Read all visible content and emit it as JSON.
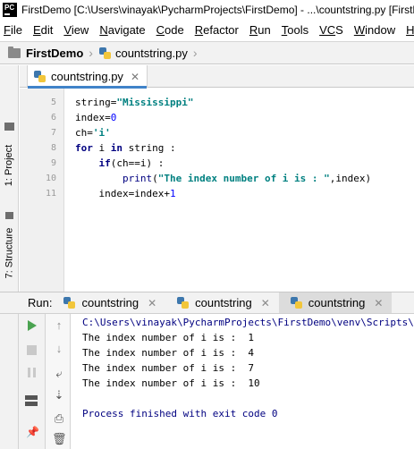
{
  "window": {
    "title": "FirstDemo [C:\\Users\\vinayak\\PycharmProjects\\FirstDemo] - ...\\countstring.py [FirstDemo] - PyCharm",
    "logo_text": "PC"
  },
  "menu": [
    {
      "mnemonic": "F",
      "rest": "ile"
    },
    {
      "mnemonic": "E",
      "rest": "dit"
    },
    {
      "mnemonic": "V",
      "rest": "iew"
    },
    {
      "mnemonic": "N",
      "rest": "avigate"
    },
    {
      "mnemonic": "C",
      "rest": "ode"
    },
    {
      "mnemonic": "R",
      "rest": "efactor"
    },
    {
      "mnemonic": "R",
      "rest": "un"
    },
    {
      "mnemonic": "T",
      "rest": "ools"
    },
    {
      "mnemonic": "VC",
      "rest": "S"
    },
    {
      "mnemonic": "W",
      "rest": "indow"
    },
    {
      "mnemonic": "H",
      "rest": "elp"
    }
  ],
  "navbar": {
    "project": "FirstDemo",
    "file": "countstring.py"
  },
  "side_tabs": {
    "project": "1: Project",
    "structure": "7: Structure"
  },
  "editor": {
    "tab_label": "countstring.py",
    "lines": [
      {
        "number": "5",
        "code": "string=\"Mississippi\""
      },
      {
        "number": "6",
        "code": "index=0"
      },
      {
        "number": "7",
        "code": "ch='i'"
      },
      {
        "number": "8",
        "code": "for i in string :"
      },
      {
        "number": "9",
        "code": "    if(ch==i) :"
      },
      {
        "number": "10",
        "code": "        print(\"The index number of i is : \",index)"
      },
      {
        "number": "11",
        "code": "    index=index+1"
      }
    ]
  },
  "run": {
    "title": "Run:",
    "tabs": [
      "countstring",
      "countstring",
      "countstring"
    ],
    "active_tab": 2,
    "console": {
      "path": "C:\\Users\\vinayak\\PycharmProjects\\FirstDemo\\venv\\Scripts\\python.exe",
      "output": [
        "The index number of i is :  1",
        "The index number of i is :  4",
        "The index number of i is :  7",
        "The index number of i is :  10"
      ],
      "exit": "Process finished with exit code 0"
    }
  },
  "icons": {
    "rerun": "play-icon",
    "stop": "stop-icon",
    "pause": "pause-icon",
    "up": "arrow-up-icon",
    "down": "arrow-down-icon",
    "wrap": "soft-wrap-icon",
    "scroll": "scroll-to-end-icon",
    "print": "print-icon",
    "trash": "trash-icon",
    "layout": "layout-icon",
    "pin": "pin-icon"
  },
  "colors": {
    "keyword": "#000080",
    "string": "#008080",
    "number": "#0000ff",
    "run_green": "#4aa350",
    "tab_underline": "#4083c9"
  }
}
